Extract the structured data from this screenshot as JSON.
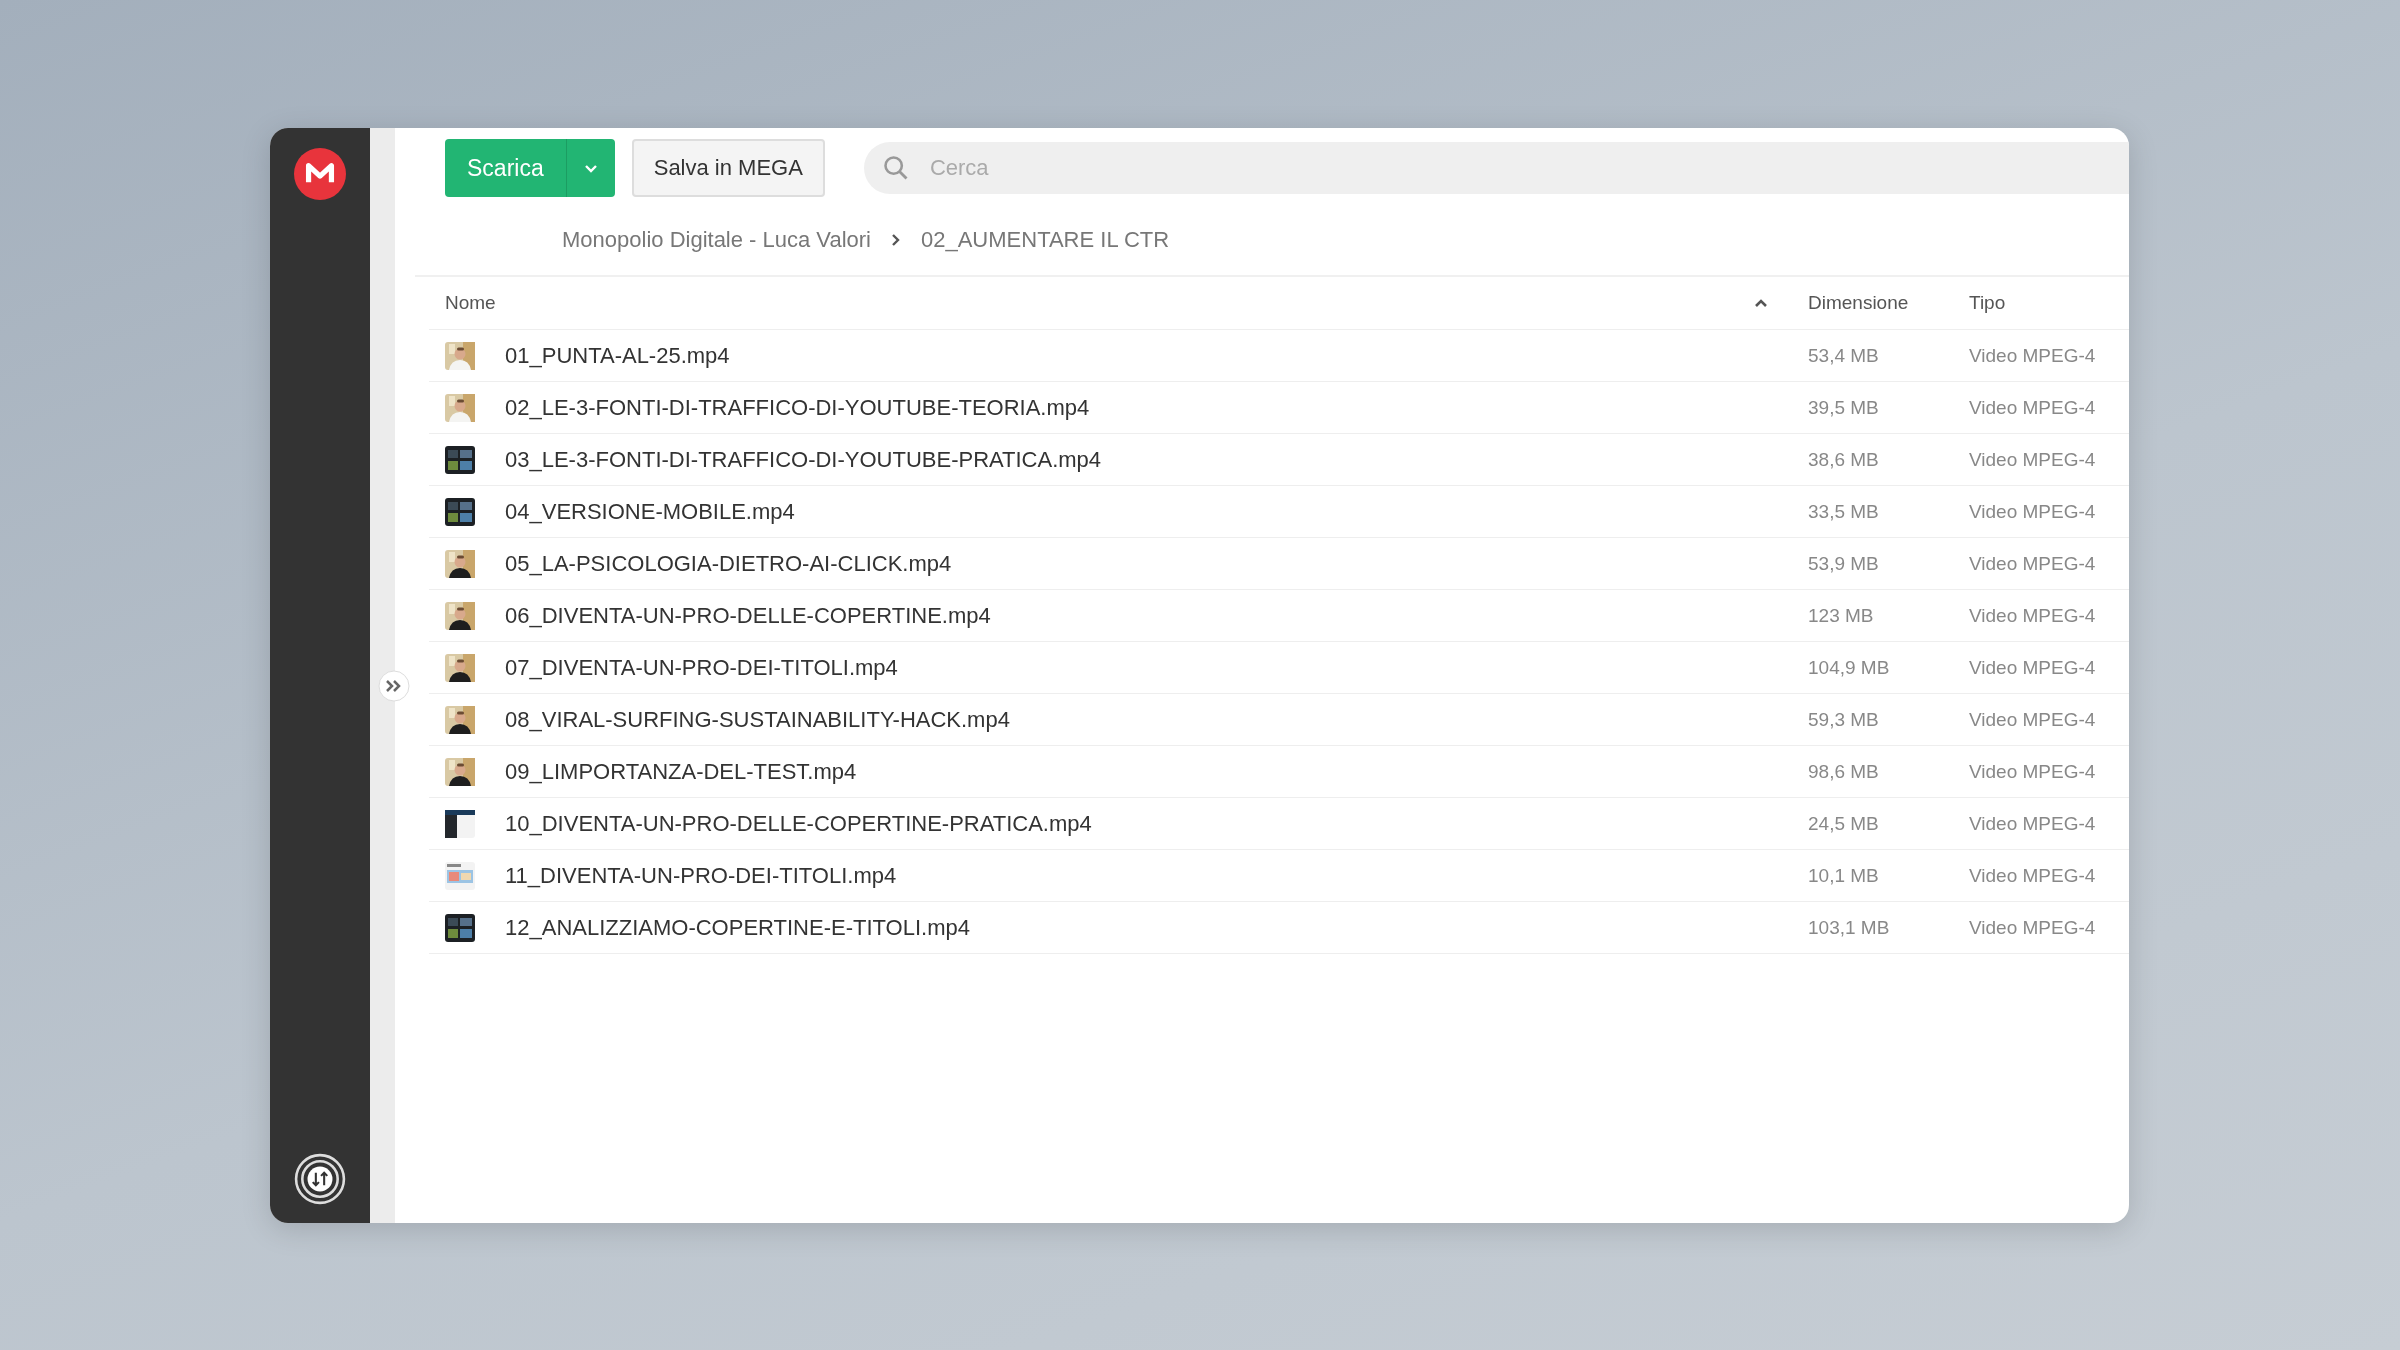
{
  "toolbar": {
    "download_button": "Scarica",
    "save_button": "Salva in MEGA",
    "search": {
      "placeholder": "Cerca"
    }
  },
  "breadcrumb": [
    "Monopolio Digitale - Luca Valori",
    "02_AUMENTARE IL CTR"
  ],
  "table": {
    "columns": [
      {
        "label": "Nome",
        "sorted": true
      },
      {
        "label": "Dimensione",
        "sorted": false
      },
      {
        "label": "Tipo",
        "sorted": false
      }
    ],
    "rows": [
      {
        "name": "01_PUNTA-AL-25.mp4",
        "size": "53,4 MB",
        "type": "Video MPEG-4"
      },
      {
        "name": "02_LE-3-FONTI-DI-TRAFFICO-DI-YOUTUBE-TEORIA.mp4",
        "size": "39,5 MB",
        "type": "Video MPEG-4"
      },
      {
        "name": "03_LE-3-FONTI-DI-TRAFFICO-DI-YOUTUBE-PRATICA.mp4",
        "size": "38,6 MB",
        "type": "Video MPEG-4"
      },
      {
        "name": "04_VERSIONE-MOBILE.mp4",
        "size": "33,5 MB",
        "type": "Video MPEG-4"
      },
      {
        "name": "05_LA-PSICOLOGIA-DIETRO-AI-CLICK.mp4",
        "size": "53,9 MB",
        "type": "Video MPEG-4"
      },
      {
        "name": "06_DIVENTA-UN-PRO-DELLE-COPERTINE.mp4",
        "size": "123 MB",
        "type": "Video MPEG-4"
      },
      {
        "name": "07_DIVENTA-UN-PRO-DEI-TITOLI.mp4",
        "size": "104,9 MB",
        "type": "Video MPEG-4"
      },
      {
        "name": "08_VIRAL-SURFING-SUSTAINABILITY-HACK.mp4",
        "size": "59,3 MB",
        "type": "Video MPEG-4"
      },
      {
        "name": "09_LIMPORTANZA-DEL-TEST.mp4",
        "size": "98,6 MB",
        "type": "Video MPEG-4"
      },
      {
        "name": "10_DIVENTA-UN-PRO-DELLE-COPERTINE-PRATICA.mp4",
        "size": "24,5 MB",
        "type": "Video MPEG-4"
      },
      {
        "name": "11_DIVENTA-UN-PRO-DEI-TITOLI.mp4",
        "size": "10,1 MB",
        "type": "Video MPEG-4"
      },
      {
        "name": "12_ANALIZZIAMO-COPERTINE-E-TITOLI.mp4",
        "size": "103,1 MB",
        "type": "Video MPEG-4"
      }
    ]
  }
}
